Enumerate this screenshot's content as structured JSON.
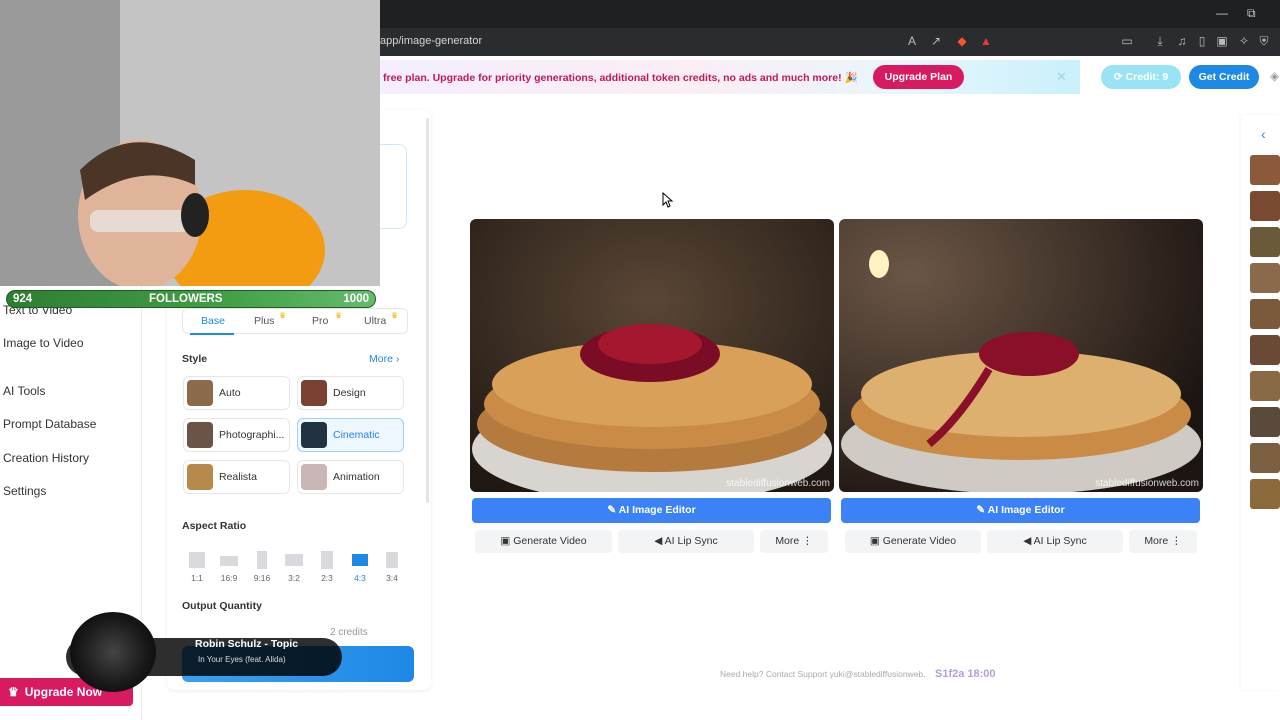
{
  "browser": {
    "url": "app/image-generator",
    "window_controls": [
      "—",
      "⧉"
    ]
  },
  "banner": {
    "text": "free plan. Upgrade for priority generations, additional token credits, no ads and much more! 🎉",
    "upgrade_label": "Upgrade Plan",
    "close_label": "✕"
  },
  "header": {
    "credit_label": "Credit: 9",
    "get_credit_label": "Get Credit"
  },
  "sidebar": {
    "items": [
      {
        "label": "Text to Video"
      },
      {
        "label": "Image to Video"
      },
      {
        "label": "AI Tools"
      },
      {
        "label": "Prompt Database"
      },
      {
        "label": "Creation History"
      },
      {
        "label": "Settings"
      }
    ],
    "upgrade_label": "Upgrade Now"
  },
  "settings": {
    "model_tabs": [
      {
        "label": "Base",
        "active": true
      },
      {
        "label": "Plus",
        "premium": true
      },
      {
        "label": "Pro",
        "premium": true
      },
      {
        "label": "Ultra",
        "premium": true
      }
    ],
    "style_label": "Style",
    "more_label": "More",
    "styles": [
      {
        "label": "Auto",
        "color": "#8a6a4a"
      },
      {
        "label": "Design",
        "color": "#7a4030"
      },
      {
        "label": "Photographi...",
        "color": "#6b5346"
      },
      {
        "label": "Cinematic",
        "color": "#1f3340",
        "selected": true
      },
      {
        "label": "Realista",
        "color": "#b58a4a"
      },
      {
        "label": "Animation",
        "color": "#c8b7b4"
      }
    ],
    "aspect_label": "Aspect Ratio",
    "ratios": [
      {
        "label": "1:1"
      },
      {
        "label": "16:9"
      },
      {
        "label": "9:16"
      },
      {
        "label": "3:2"
      },
      {
        "label": "2:3"
      },
      {
        "label": "4:3",
        "active": true
      },
      {
        "label": "3:4"
      }
    ],
    "output_label": "Output Quantity",
    "credits_label": "2 credits"
  },
  "results": {
    "cards": [
      {
        "watermark": "stablediffusionweb.com",
        "editor_label": "AI Image Editor",
        "video_label": "Generate Video",
        "lipsync_label": "AI Lip Sync",
        "more_label": "More"
      },
      {
        "watermark": "stablediffusionweb.com",
        "editor_label": "AI Image Editor",
        "video_label": "Generate Video",
        "lipsync_label": "AI Lip Sync",
        "more_label": "More"
      }
    ]
  },
  "footer": {
    "help_text": "Need help? Contact Support yuki@stablediffusionweb.",
    "time_text": "S1f2a 18:00"
  },
  "stream_overlay": {
    "followers_current": "924",
    "followers_label": "FOLLOWERS",
    "followers_goal": "1000",
    "followers_progress": 0.924,
    "music_title": "Robin Schulz - Topic",
    "music_subtitle": "In Your Eyes (feat. Alida)"
  },
  "colors": {
    "accent": "#1e88e5",
    "brand_pink": "#d81b60",
    "editor_blue": "#3b82f6"
  }
}
